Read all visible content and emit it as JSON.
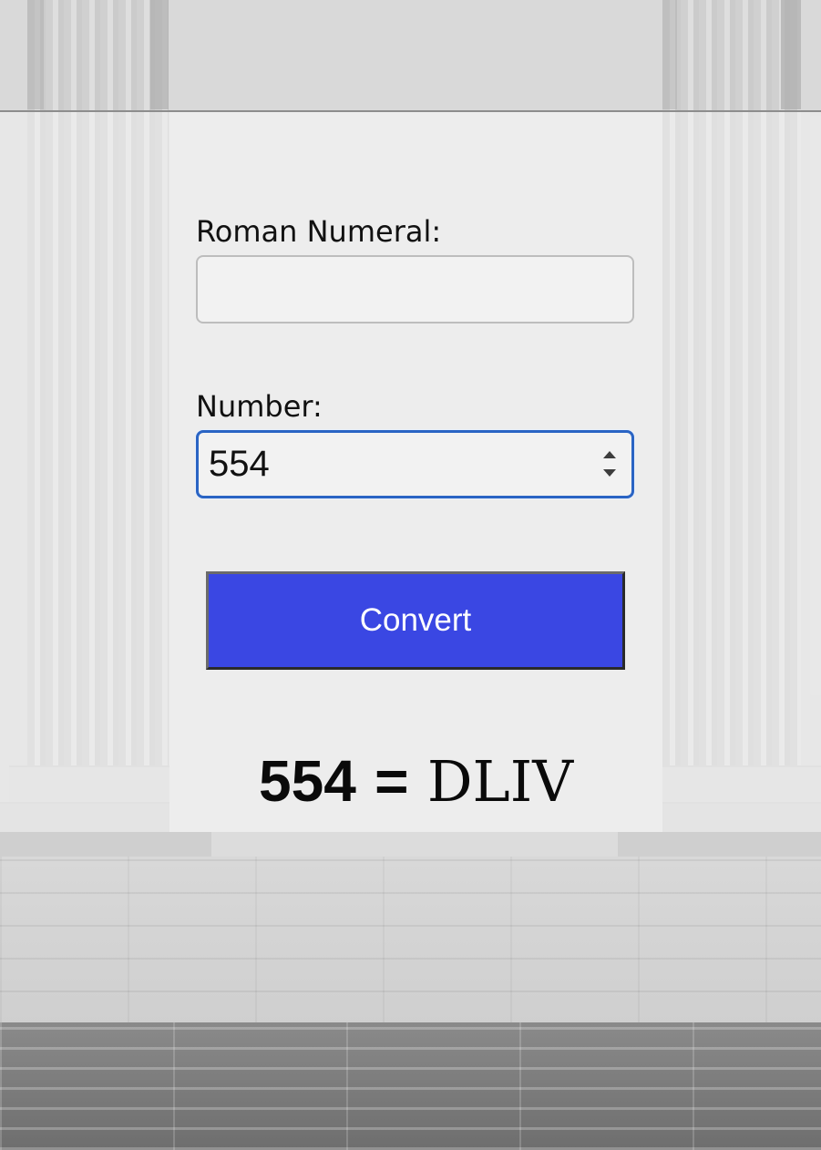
{
  "form": {
    "roman_label": "Roman Numeral:",
    "roman_value": "",
    "number_label": "Number:",
    "number_value": "554",
    "convert_label": "Convert"
  },
  "result": {
    "number": "554",
    "equals": "=",
    "roman": "DLIV"
  },
  "colors": {
    "button": "#3a47e3",
    "focus_border": "#2a64c4"
  },
  "icons": {
    "spinner_up": "chevron-up-icon",
    "spinner_down": "chevron-down-icon"
  }
}
